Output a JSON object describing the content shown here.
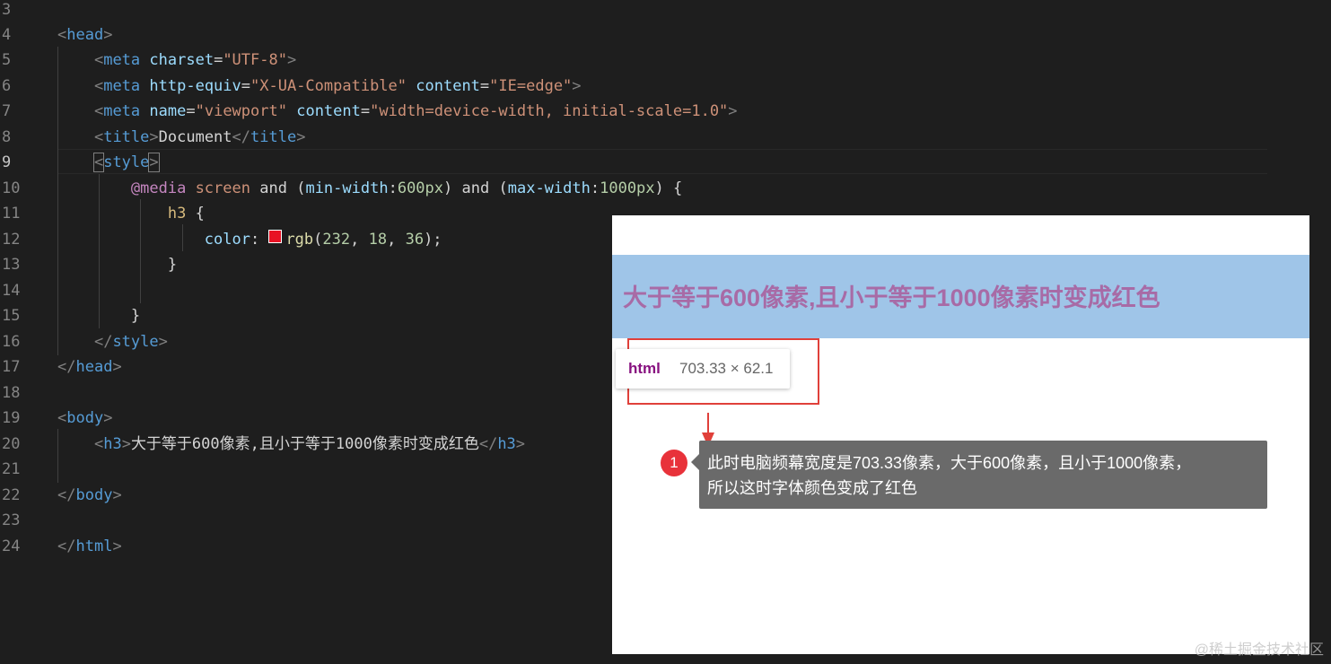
{
  "editor": {
    "lines": [
      {
        "num": "3",
        "code": ""
      },
      {
        "num": "4",
        "code": "<head>"
      },
      {
        "num": "5",
        "code": "    <meta charset=\"UTF-8\">"
      },
      {
        "num": "6",
        "code": "    <meta http-equiv=\"X-UA-Compatible\" content=\"IE=edge\">"
      },
      {
        "num": "7",
        "code": "    <meta name=\"viewport\" content=\"width=device-width, initial-scale=1.0\">"
      },
      {
        "num": "8",
        "code": "    <title>Document</title>"
      },
      {
        "num": "9",
        "code": "    <style>"
      },
      {
        "num": "10",
        "code": "        @media screen and (min-width:600px) and (max-width:1000px) {"
      },
      {
        "num": "11",
        "code": "            h3 {"
      },
      {
        "num": "12",
        "code": "                color: rgb(232, 18, 36);"
      },
      {
        "num": "13",
        "code": "            }"
      },
      {
        "num": "14",
        "code": ""
      },
      {
        "num": "15",
        "code": "        }"
      },
      {
        "num": "16",
        "code": "    </style>"
      },
      {
        "num": "17",
        "code": "</head>"
      },
      {
        "num": "18",
        "code": ""
      },
      {
        "num": "19",
        "code": "<body>"
      },
      {
        "num": "20",
        "code": "    <h3>大于等于600像素,且小于等于1000像素时变成红色</h3>"
      },
      {
        "num": "21",
        "code": ""
      },
      {
        "num": "22",
        "code": "</body>"
      },
      {
        "num": "23",
        "code": ""
      },
      {
        "num": "24",
        "code": "</html>"
      }
    ],
    "active_line": "9",
    "swatch_color": "#e81224"
  },
  "preview": {
    "h3_text": "大于等于600像素,且小于等于1000像素时变成红色",
    "h3_color": "#a86ba6",
    "h3_bg": "#9fc5e8",
    "tooltip": {
      "tag": "html",
      "dims": "703.33 × 62.1"
    }
  },
  "annotation": {
    "badge": "1",
    "note_line1": "此时电脑频幕宽度是703.33像素，大于600像素，且小于1000像素，",
    "note_line2": "所以这时字体颜色变成了红色"
  },
  "watermark": "@稀土掘金技术社区"
}
